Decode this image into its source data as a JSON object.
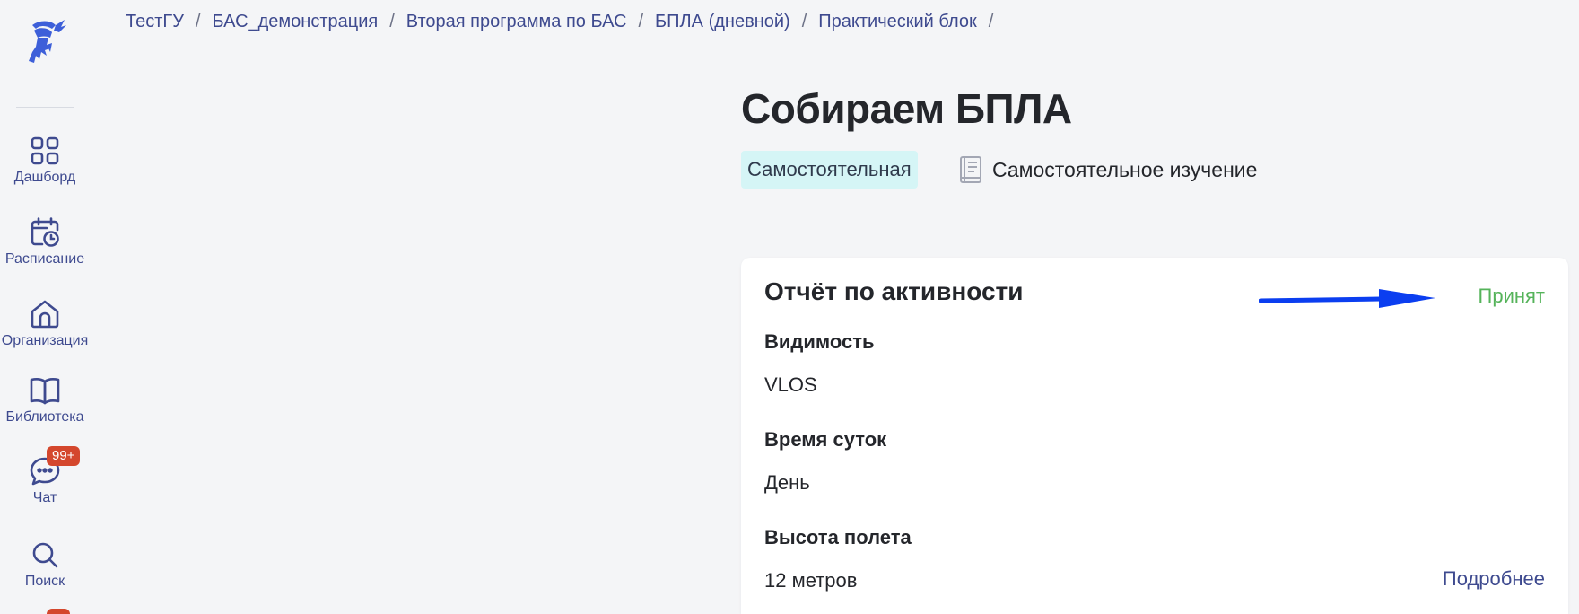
{
  "app": {
    "logo": "viking-helmet-logo"
  },
  "sidebar": {
    "items": [
      {
        "label": "Дашборд",
        "icon": "dashboard-grid-icon"
      },
      {
        "label": "Расписание",
        "icon": "calendar-clock-icon"
      },
      {
        "label": "Организация",
        "icon": "organization-home-icon"
      },
      {
        "label": "Библиотека",
        "icon": "book-open-icon"
      },
      {
        "label": "Чат",
        "icon": "chat-bubble-icon",
        "badge": "99+"
      },
      {
        "label": "Поиск",
        "icon": "search-icon"
      }
    ]
  },
  "breadcrumbs": [
    "ТестГУ",
    "БАС_демонстрация",
    "Вторая программа по БАС",
    "БПЛА (дневной)",
    "Практический блок"
  ],
  "breadcrumb_separator": "/",
  "header": {
    "title": "Собираем БПЛА",
    "type_tag": "Самостоятельная",
    "study_mode": "Самостоятельное изучение",
    "study_mode_icon": "book-icon"
  },
  "card": {
    "title": "Отчёт по активности",
    "status": "Принят",
    "status_color": "#55b35a",
    "annotation": "blue-arrow-pointing-right",
    "fields": [
      {
        "label": "Видимость",
        "value": "VLOS"
      },
      {
        "label": "Время суток",
        "value": "День"
      },
      {
        "label": "Высота полета",
        "value": "12 метров"
      }
    ],
    "more_link": "Подробнее"
  },
  "colors": {
    "accent": "#3e4a8f",
    "tag_bg": "#d5f5f6",
    "badge": "#d4472d",
    "arrow": "#0b3ef0"
  }
}
